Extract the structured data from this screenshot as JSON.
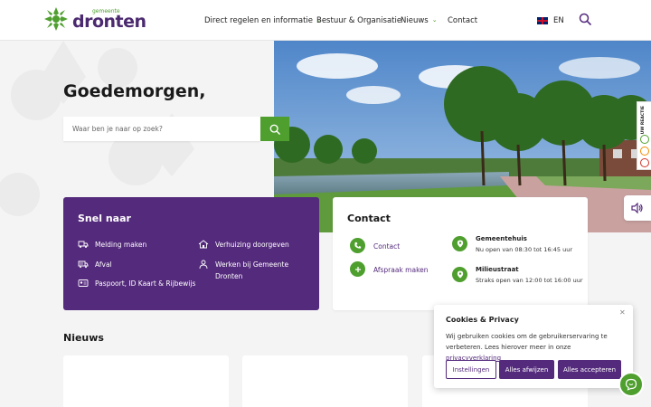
{
  "header": {
    "logo_small": "gemeente",
    "logo_big": "dronten",
    "nav": [
      {
        "label": "Direct regelen en informatie",
        "dropdown": true
      },
      {
        "label": "Bestuur & Organisatie",
        "dropdown": false
      },
      {
        "label": "Nieuws",
        "dropdown": true
      },
      {
        "label": "Contact",
        "dropdown": false
      }
    ],
    "language": "EN"
  },
  "hero": {
    "greeting": "Goedemorgen,",
    "search_placeholder": "Waar ben je naar op zoek?",
    "side_tab_label": "UW REACTIE"
  },
  "snel_naar": {
    "title": "Snel naar",
    "items": [
      {
        "label": "Melding maken",
        "icon": "truck-alert-icon"
      },
      {
        "label": "Verhuizing doorgeven",
        "icon": "house-icon"
      },
      {
        "label": "Afval",
        "icon": "garbage-truck-icon"
      },
      {
        "label": "Werken bij Gemeente Dronten",
        "icon": "person-icon"
      },
      {
        "label": "Paspoort, ID Kaart & Rijbewijs",
        "icon": "id-card-icon"
      }
    ]
  },
  "contact": {
    "title": "Contact",
    "links": [
      {
        "label": "Contact",
        "icon": "phone-icon"
      },
      {
        "label": "Afspraak maken",
        "icon": "plus-icon"
      }
    ],
    "locations": [
      {
        "name": "Gemeentehuis",
        "hours": "Nu open van 08:30 tot 16:45 uur"
      },
      {
        "name": "Milieustraat",
        "hours": "Straks open van 12:00 tot 16:00 uur"
      }
    ]
  },
  "news": {
    "title": "Nieuws"
  },
  "cookie": {
    "title": "Cookies & Privacy",
    "text_before": "Wij gebruiken cookies om de gebruikerservaring te verbeteren. Lees hierover meer in onze ",
    "link": "privacyverklaring",
    "buttons": {
      "settings": "Instellingen",
      "reject": "Alles afwijzen",
      "accept": "Alles accepteren"
    }
  },
  "colors": {
    "purple": "#542a7c",
    "green": "#4f9f2f"
  }
}
